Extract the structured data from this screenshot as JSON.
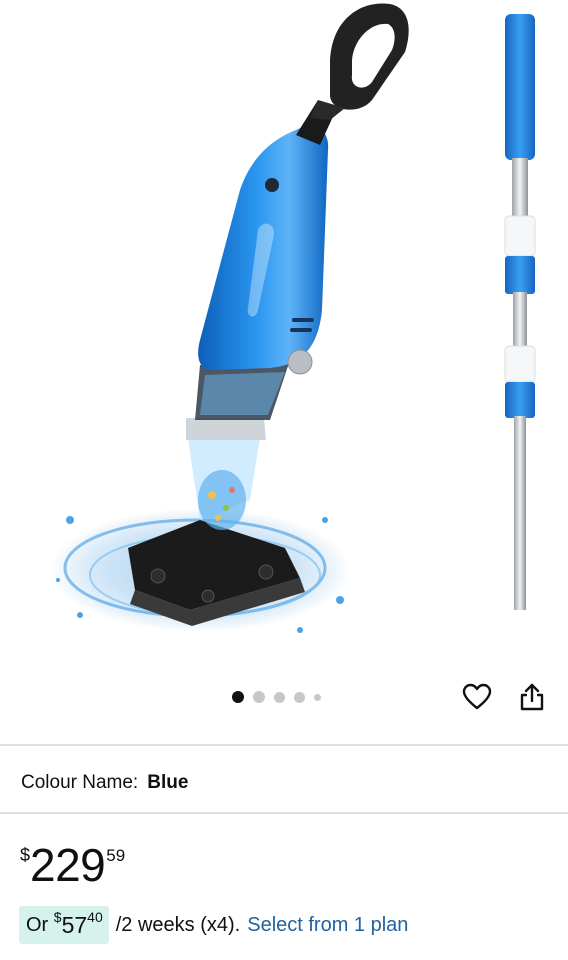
{
  "product": {
    "image_alt": "Blue handheld pool vacuum with telescopic pole",
    "image_count": 5,
    "active_image_index": 0
  },
  "actions": {
    "wishlist_icon": "heart-outline-icon",
    "share_icon": "share-icon"
  },
  "variant": {
    "label": "Colour Name:",
    "value": "Blue"
  },
  "price": {
    "symbol": "$",
    "whole": "229",
    "fraction": "59"
  },
  "installment": {
    "prefix": "Or",
    "symbol": "$",
    "whole": "57",
    "fraction": "40",
    "term": "/2 weeks (x4).",
    "link": "Select from 1 plan"
  },
  "colors": {
    "product_blue": "#1f8ae6",
    "pill_background": "#d6f2ec",
    "link": "#2162a1",
    "text": "#0f1111"
  }
}
